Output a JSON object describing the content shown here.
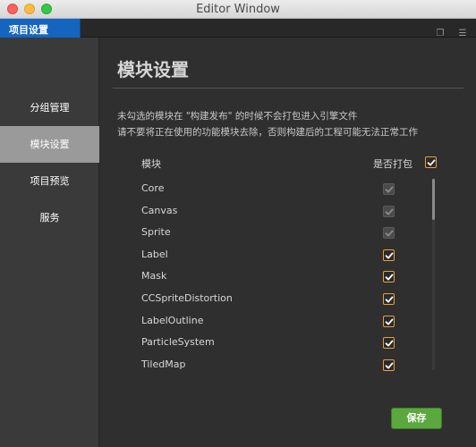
{
  "window": {
    "title": "Editor Window"
  },
  "tab": {
    "label": "项目设置"
  },
  "sidebar": {
    "items": [
      {
        "label": "分组管理",
        "active": false
      },
      {
        "label": "模块设置",
        "active": true
      },
      {
        "label": "项目预览",
        "active": false
      },
      {
        "label": "服务",
        "active": false
      }
    ]
  },
  "main": {
    "title": "模块设置",
    "desc_line1": "未勾选的模块在 \"构建发布\" 的时候不会打包进入引擎文件",
    "desc_line2": "请不要将正在使用的功能模块去除，否则构建后的工程可能无法正常工作",
    "list_header": "模块",
    "pack_label": "是否打包",
    "modules": [
      {
        "name": "Core",
        "checked": true,
        "disabled": true
      },
      {
        "name": "Canvas",
        "checked": true,
        "disabled": true
      },
      {
        "name": "Sprite",
        "checked": true,
        "disabled": true
      },
      {
        "name": "Label",
        "checked": true,
        "disabled": false
      },
      {
        "name": "Mask",
        "checked": true,
        "disabled": false
      },
      {
        "name": "CCSpriteDistortion",
        "checked": true,
        "disabled": false
      },
      {
        "name": "LabelOutline",
        "checked": true,
        "disabled": false
      },
      {
        "name": "ParticleSystem",
        "checked": true,
        "disabled": false
      },
      {
        "name": "TiledMap",
        "checked": true,
        "disabled": false
      }
    ],
    "save_label": "保存"
  },
  "colors": {
    "accent_tab": "#1565c0",
    "checkbox_orange": "#e8a03e",
    "save_green": "#5aa83e"
  }
}
